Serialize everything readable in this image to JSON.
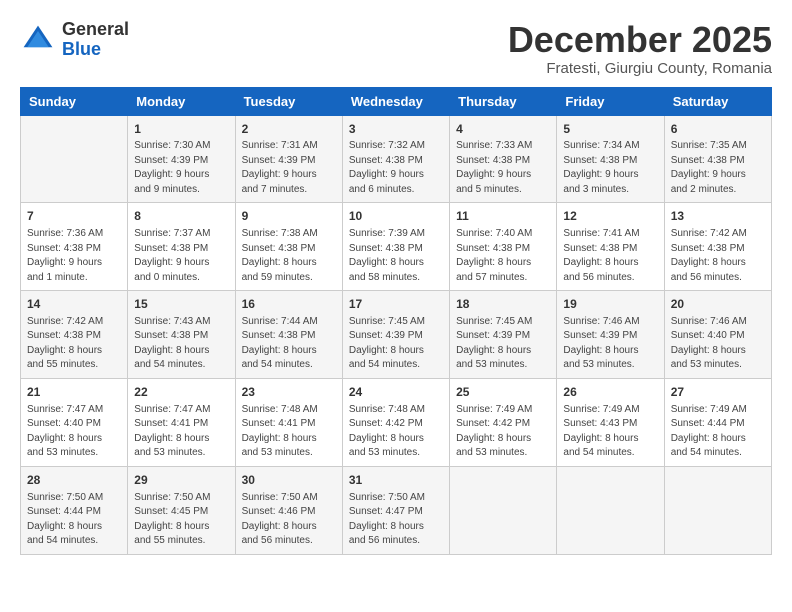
{
  "header": {
    "logo_general": "General",
    "logo_blue": "Blue",
    "month": "December 2025",
    "location": "Fratesti, Giurgiu County, Romania"
  },
  "weekdays": [
    "Sunday",
    "Monday",
    "Tuesday",
    "Wednesday",
    "Thursday",
    "Friday",
    "Saturday"
  ],
  "weeks": [
    [
      {
        "day": "",
        "sunrise": "",
        "sunset": "",
        "daylight": ""
      },
      {
        "day": "1",
        "sunrise": "Sunrise: 7:30 AM",
        "sunset": "Sunset: 4:39 PM",
        "daylight": "Daylight: 9 hours and 9 minutes."
      },
      {
        "day": "2",
        "sunrise": "Sunrise: 7:31 AM",
        "sunset": "Sunset: 4:39 PM",
        "daylight": "Daylight: 9 hours and 7 minutes."
      },
      {
        "day": "3",
        "sunrise": "Sunrise: 7:32 AM",
        "sunset": "Sunset: 4:38 PM",
        "daylight": "Daylight: 9 hours and 6 minutes."
      },
      {
        "day": "4",
        "sunrise": "Sunrise: 7:33 AM",
        "sunset": "Sunset: 4:38 PM",
        "daylight": "Daylight: 9 hours and 5 minutes."
      },
      {
        "day": "5",
        "sunrise": "Sunrise: 7:34 AM",
        "sunset": "Sunset: 4:38 PM",
        "daylight": "Daylight: 9 hours and 3 minutes."
      },
      {
        "day": "6",
        "sunrise": "Sunrise: 7:35 AM",
        "sunset": "Sunset: 4:38 PM",
        "daylight": "Daylight: 9 hours and 2 minutes."
      }
    ],
    [
      {
        "day": "7",
        "sunrise": "Sunrise: 7:36 AM",
        "sunset": "Sunset: 4:38 PM",
        "daylight": "Daylight: 9 hours and 1 minute."
      },
      {
        "day": "8",
        "sunrise": "Sunrise: 7:37 AM",
        "sunset": "Sunset: 4:38 PM",
        "daylight": "Daylight: 9 hours and 0 minutes."
      },
      {
        "day": "9",
        "sunrise": "Sunrise: 7:38 AM",
        "sunset": "Sunset: 4:38 PM",
        "daylight": "Daylight: 8 hours and 59 minutes."
      },
      {
        "day": "10",
        "sunrise": "Sunrise: 7:39 AM",
        "sunset": "Sunset: 4:38 PM",
        "daylight": "Daylight: 8 hours and 58 minutes."
      },
      {
        "day": "11",
        "sunrise": "Sunrise: 7:40 AM",
        "sunset": "Sunset: 4:38 PM",
        "daylight": "Daylight: 8 hours and 57 minutes."
      },
      {
        "day": "12",
        "sunrise": "Sunrise: 7:41 AM",
        "sunset": "Sunset: 4:38 PM",
        "daylight": "Daylight: 8 hours and 56 minutes."
      },
      {
        "day": "13",
        "sunrise": "Sunrise: 7:42 AM",
        "sunset": "Sunset: 4:38 PM",
        "daylight": "Daylight: 8 hours and 56 minutes."
      }
    ],
    [
      {
        "day": "14",
        "sunrise": "Sunrise: 7:42 AM",
        "sunset": "Sunset: 4:38 PM",
        "daylight": "Daylight: 8 hours and 55 minutes."
      },
      {
        "day": "15",
        "sunrise": "Sunrise: 7:43 AM",
        "sunset": "Sunset: 4:38 PM",
        "daylight": "Daylight: 8 hours and 54 minutes."
      },
      {
        "day": "16",
        "sunrise": "Sunrise: 7:44 AM",
        "sunset": "Sunset: 4:38 PM",
        "daylight": "Daylight: 8 hours and 54 minutes."
      },
      {
        "day": "17",
        "sunrise": "Sunrise: 7:45 AM",
        "sunset": "Sunset: 4:39 PM",
        "daylight": "Daylight: 8 hours and 54 minutes."
      },
      {
        "day": "18",
        "sunrise": "Sunrise: 7:45 AM",
        "sunset": "Sunset: 4:39 PM",
        "daylight": "Daylight: 8 hours and 53 minutes."
      },
      {
        "day": "19",
        "sunrise": "Sunrise: 7:46 AM",
        "sunset": "Sunset: 4:39 PM",
        "daylight": "Daylight: 8 hours and 53 minutes."
      },
      {
        "day": "20",
        "sunrise": "Sunrise: 7:46 AM",
        "sunset": "Sunset: 4:40 PM",
        "daylight": "Daylight: 8 hours and 53 minutes."
      }
    ],
    [
      {
        "day": "21",
        "sunrise": "Sunrise: 7:47 AM",
        "sunset": "Sunset: 4:40 PM",
        "daylight": "Daylight: 8 hours and 53 minutes."
      },
      {
        "day": "22",
        "sunrise": "Sunrise: 7:47 AM",
        "sunset": "Sunset: 4:41 PM",
        "daylight": "Daylight: 8 hours and 53 minutes."
      },
      {
        "day": "23",
        "sunrise": "Sunrise: 7:48 AM",
        "sunset": "Sunset: 4:41 PM",
        "daylight": "Daylight: 8 hours and 53 minutes."
      },
      {
        "day": "24",
        "sunrise": "Sunrise: 7:48 AM",
        "sunset": "Sunset: 4:42 PM",
        "daylight": "Daylight: 8 hours and 53 minutes."
      },
      {
        "day": "25",
        "sunrise": "Sunrise: 7:49 AM",
        "sunset": "Sunset: 4:42 PM",
        "daylight": "Daylight: 8 hours and 53 minutes."
      },
      {
        "day": "26",
        "sunrise": "Sunrise: 7:49 AM",
        "sunset": "Sunset: 4:43 PM",
        "daylight": "Daylight: 8 hours and 54 minutes."
      },
      {
        "day": "27",
        "sunrise": "Sunrise: 7:49 AM",
        "sunset": "Sunset: 4:44 PM",
        "daylight": "Daylight: 8 hours and 54 minutes."
      }
    ],
    [
      {
        "day": "28",
        "sunrise": "Sunrise: 7:50 AM",
        "sunset": "Sunset: 4:44 PM",
        "daylight": "Daylight: 8 hours and 54 minutes."
      },
      {
        "day": "29",
        "sunrise": "Sunrise: 7:50 AM",
        "sunset": "Sunset: 4:45 PM",
        "daylight": "Daylight: 8 hours and 55 minutes."
      },
      {
        "day": "30",
        "sunrise": "Sunrise: 7:50 AM",
        "sunset": "Sunset: 4:46 PM",
        "daylight": "Daylight: 8 hours and 56 minutes."
      },
      {
        "day": "31",
        "sunrise": "Sunrise: 7:50 AM",
        "sunset": "Sunset: 4:47 PM",
        "daylight": "Daylight: 8 hours and 56 minutes."
      },
      {
        "day": "",
        "sunrise": "",
        "sunset": "",
        "daylight": ""
      },
      {
        "day": "",
        "sunrise": "",
        "sunset": "",
        "daylight": ""
      },
      {
        "day": "",
        "sunrise": "",
        "sunset": "",
        "daylight": ""
      }
    ]
  ]
}
